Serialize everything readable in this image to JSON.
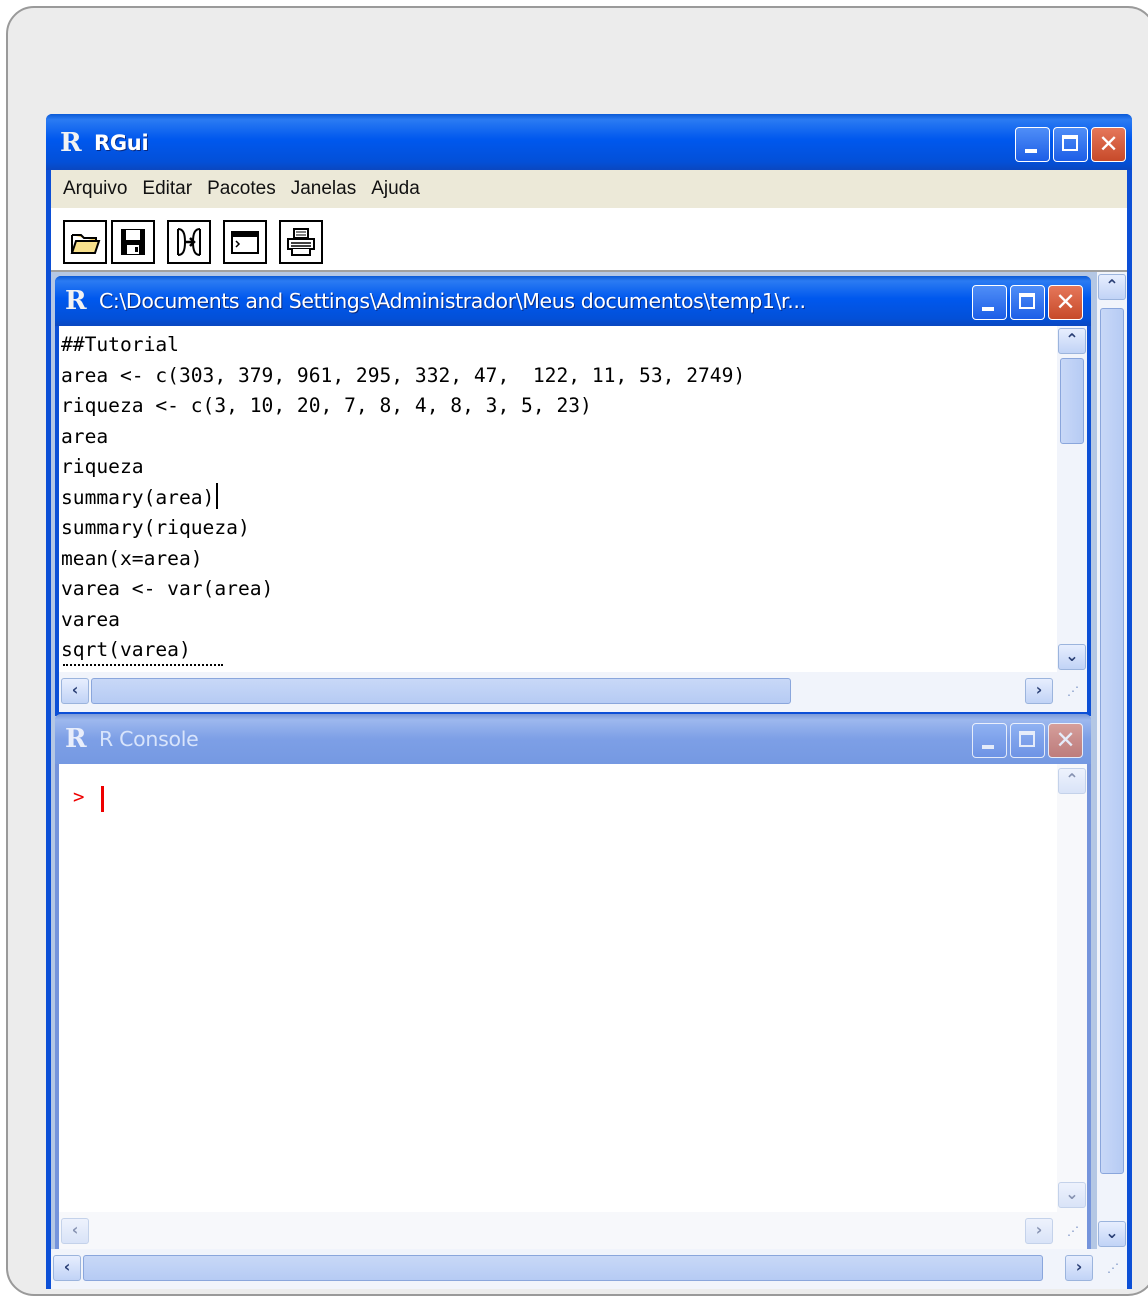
{
  "main_window": {
    "title": "RGui",
    "icon": "r-logo-icon"
  },
  "menu": {
    "items": [
      "Arquivo",
      "Editar",
      "Pacotes",
      "Janelas",
      "Ajuda"
    ]
  },
  "toolbar": {
    "buttons": [
      "open-script-icon",
      "save-icon",
      "load-workspace-icon",
      "console-icon",
      "print-icon"
    ]
  },
  "editor": {
    "title": "C:\\Documents and Settings\\Administrador\\Meus documentos\\temp1\\r...",
    "lines": [
      "##Tutorial",
      "area <- c(303, 379, 961, 295, 332, 47,  122, 11, 53, 2749)",
      "riqueza <- c(3, 10, 20, 7, 8, 4, 8, 3, 5, 23)",
      "area",
      "riqueza",
      "summary(area)",
      "summary(riqueza)",
      "mean(x=area)",
      "varea <- var(area)",
      "varea",
      "sqrt(varea)"
    ]
  },
  "console": {
    "title": "R Console",
    "prompt": ">"
  },
  "colors": {
    "title_active": "#0058ee",
    "title_inactive": "#7d9fe6",
    "menu_bg": "#ece9d8",
    "prompt_red": "#e00000"
  }
}
